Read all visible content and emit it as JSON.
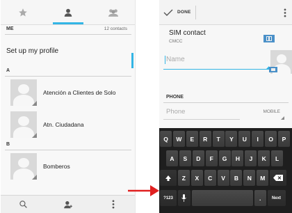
{
  "colors": {
    "accent": "#33b5e5",
    "keyboard_bg": "#1e1e1e",
    "arrow": "#e02020"
  },
  "contacts_screen": {
    "tabs": [
      {
        "icon": "star-icon",
        "label": ""
      },
      {
        "icon": "person-icon",
        "label": "",
        "selected": true
      },
      {
        "icon": "group-icon",
        "label": ""
      }
    ],
    "me_header": "ME",
    "me_count": "12 contacts",
    "profile_label": "Set up my profile",
    "section_a": "A",
    "section_b": "B",
    "contacts": [
      {
        "name": "Atención a Clientes de Solo"
      },
      {
        "name": "Atn. Ciudadana"
      },
      {
        "name": "Bomberos"
      }
    ],
    "bottom_icons": [
      "search-icon",
      "add-contact-icon",
      "overflow-menu-icon"
    ]
  },
  "edit_screen": {
    "done_label": "DONE",
    "account_name": "SIM contact",
    "account_sub": "CMCC",
    "name_placeholder": "Name",
    "phone_section": "PHONE",
    "phone_placeholder": "Phone",
    "phone_type": "MOBILE"
  },
  "keyboard": {
    "row1": [
      "Q",
      "W",
      "E",
      "R",
      "T",
      "Y",
      "U",
      "I",
      "O",
      "P"
    ],
    "row2": [
      "A",
      "S",
      "D",
      "F",
      "G",
      "H",
      "J",
      "K",
      "L"
    ],
    "row3": [
      "Z",
      "X",
      "C",
      "V",
      "B",
      "N",
      "M"
    ],
    "symbols_key": "?123",
    "period_key": ".",
    "next_key": "Next"
  }
}
